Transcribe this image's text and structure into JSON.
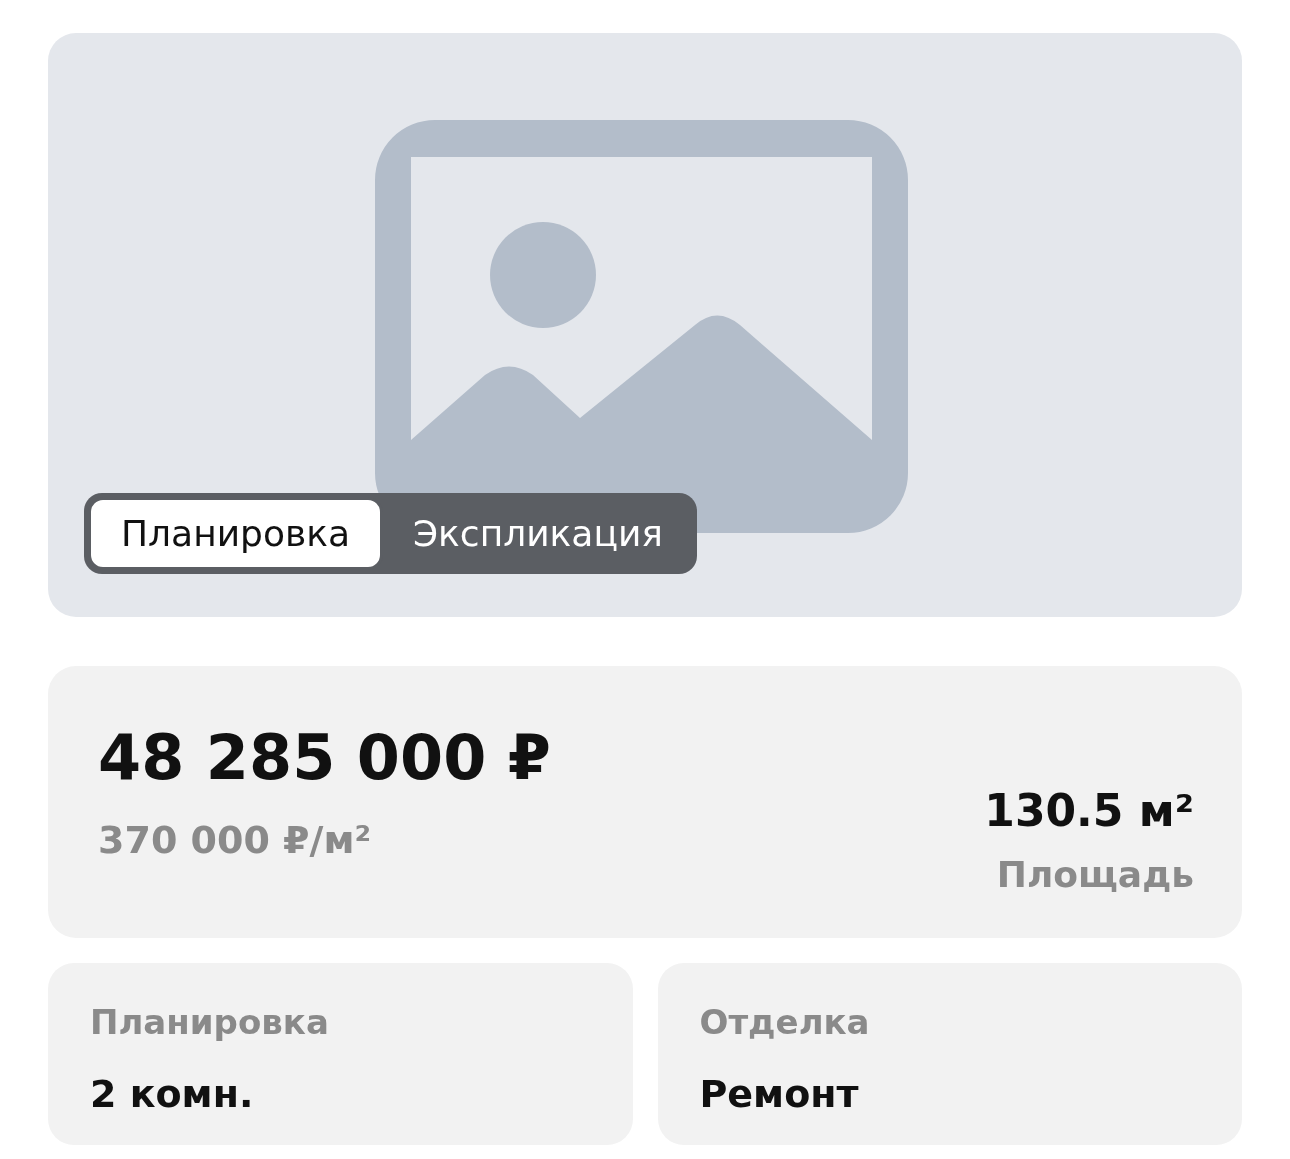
{
  "gallery": {
    "kind": "picture-placeholder",
    "tabs": [
      {
        "label": "Планировка",
        "selected": true
      },
      {
        "label": "Экспликация",
        "selected": false
      }
    ]
  },
  "summary": {
    "price": "48 285 000 ₽",
    "price_per_m2": "370 000 ₽/м²",
    "area": "130.5 м²",
    "area_label": "Площадь"
  },
  "params": [
    {
      "label": "Планировка",
      "value": "2 комн."
    },
    {
      "label": "Отделка",
      "value": "Ремонт"
    }
  ]
}
